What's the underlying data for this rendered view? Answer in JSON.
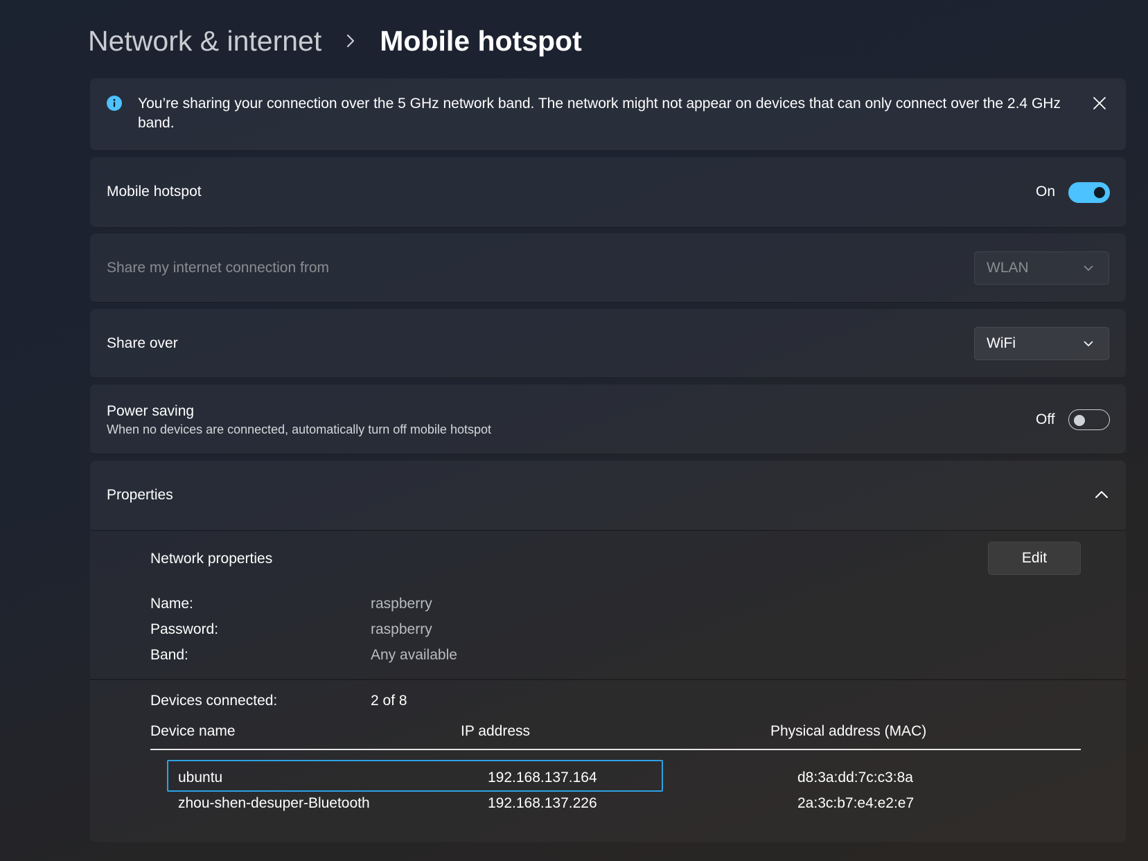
{
  "breadcrumb": {
    "parent": "Network & internet",
    "current": "Mobile hotspot"
  },
  "info_banner": {
    "text": "You’re sharing your connection over the 5 GHz network band. The network might not appear on devices that can only connect over the 2.4 GHz band."
  },
  "mobile_hotspot": {
    "label": "Mobile hotspot",
    "state": "On"
  },
  "share_from": {
    "label": "Share my internet connection from",
    "value": "WLAN"
  },
  "share_over": {
    "label": "Share over",
    "value": "WiFi"
  },
  "power_saving": {
    "label": "Power saving",
    "description": "When no devices are connected, automatically turn off mobile hotspot",
    "state": "Off"
  },
  "properties": {
    "label": "Properties",
    "network_properties_label": "Network properties",
    "edit_label": "Edit",
    "name_key": "Name:",
    "name_value": "raspberry",
    "password_key": "Password:",
    "password_value": "raspberry",
    "band_key": "Band:",
    "band_value": "Any available",
    "devices_key": "Devices connected:",
    "devices_value": "2 of 8"
  },
  "devices_table": {
    "headers": [
      "Device name",
      "IP address",
      "Physical address (MAC)"
    ],
    "rows": [
      {
        "name": "ubuntu",
        "ip": "192.168.137.164",
        "mac": "d8:3a:dd:7c:c3:8a"
      },
      {
        "name": "zhou-shen-desuper-Bluetooth",
        "ip": "192.168.137.226",
        "mac": "2a:3c:b7:e4:e2:e7"
      }
    ]
  },
  "colors": {
    "accent": "#4cc2ff",
    "focus": "#2da1e6"
  }
}
